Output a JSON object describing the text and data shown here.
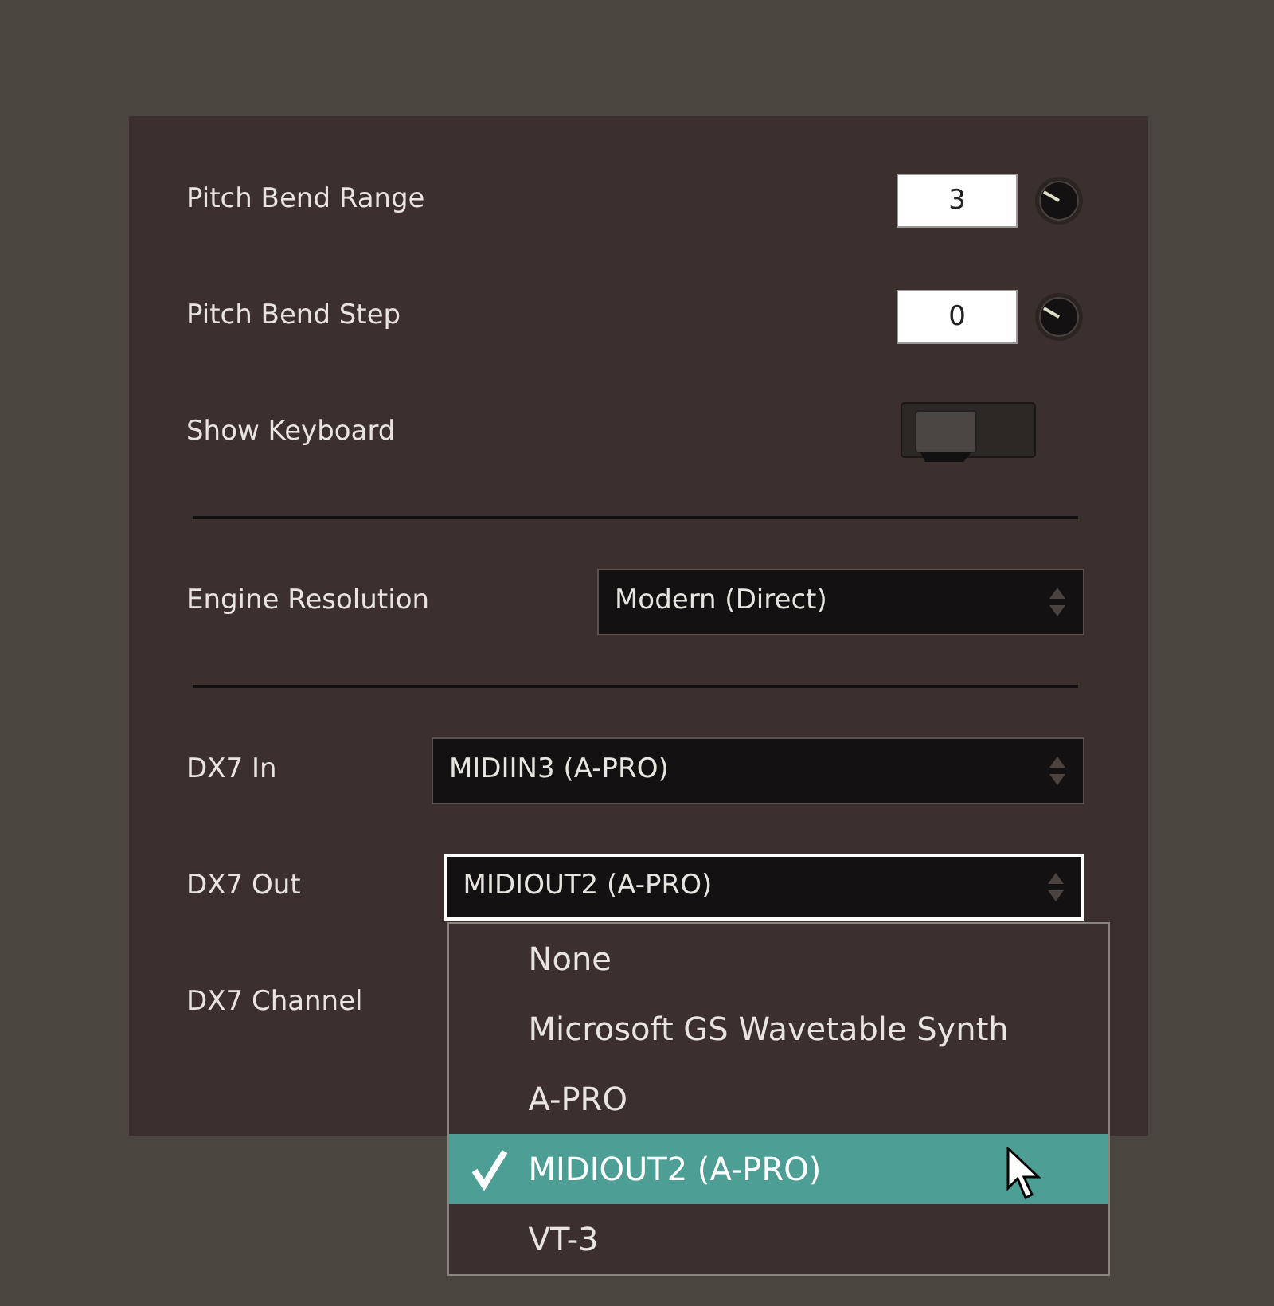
{
  "settings": [
    {
      "kind": "number",
      "label": "Pitch Bend Range",
      "value": "3"
    },
    {
      "kind": "number",
      "label": "Pitch Bend Step",
      "value": "0"
    },
    {
      "kind": "toggle",
      "label": "Show Keyboard",
      "on": false
    },
    {
      "kind": "divider"
    },
    {
      "kind": "select",
      "label": "Engine Resolution",
      "value": "Modern (Direct)",
      "expanded": false,
      "wide": false
    },
    {
      "kind": "divider"
    },
    {
      "kind": "select",
      "label": "DX7 In",
      "value": "MIDIIN3 (A-PRO)",
      "expanded": false,
      "wide": true
    },
    {
      "kind": "select",
      "label": "DX7 Out",
      "value": "MIDIOUT2 (A-PRO)",
      "expanded": true,
      "wide": true
    },
    {
      "kind": "label",
      "label": "DX7 Channel"
    }
  ],
  "menu": [
    {
      "label": "None",
      "selected": false
    },
    {
      "label": "Microsoft GS Wavetable Synth",
      "selected": false
    },
    {
      "label": "A-PRO",
      "selected": false
    },
    {
      "label": "MIDIOUT2 (A-PRO)",
      "selected": true
    },
    {
      "label": "VT-3",
      "selected": false
    }
  ]
}
